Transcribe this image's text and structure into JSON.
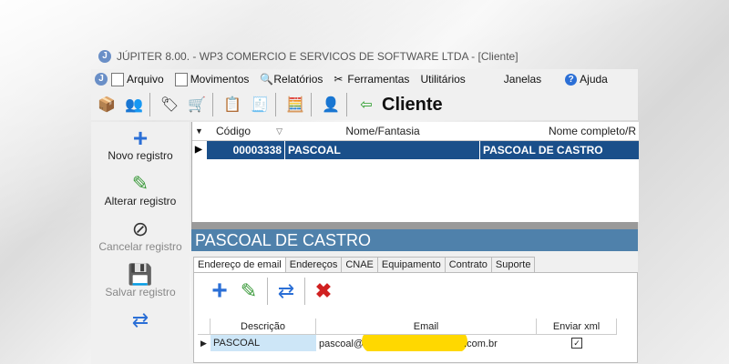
{
  "window": {
    "title": "JÚPITER 8.00. - WP3 COMERCIO E SERVICOS DE SOFTWARE LTDA - [Cliente]"
  },
  "menu": [
    {
      "label": "Arquivo",
      "icon": "document-icon"
    },
    {
      "label": "Movimentos",
      "icon": "document-icon"
    },
    {
      "label": "Relatórios",
      "icon": "print-preview-icon"
    },
    {
      "label": "Ferramentas",
      "icon": "tools-icon"
    },
    {
      "label": "Utilitários",
      "icon": ""
    },
    {
      "label": "Janelas",
      "icon": ""
    },
    {
      "label": "Ajuda",
      "icon": "help-icon"
    }
  ],
  "toolbar": {
    "title": "Cliente"
  },
  "left_panel": {
    "new": "Novo registro",
    "edit": "Alterar registro",
    "cancel": "Cancelar registro",
    "save": "Salvar registro"
  },
  "grid": {
    "columns": [
      "Código",
      "Nome/Fantasia",
      "Nome completo/R"
    ],
    "rows": [
      {
        "codigo": "00003338",
        "fantasia": "PASCOAL",
        "nome": "PASCOAL DE CASTRO"
      }
    ]
  },
  "detail": {
    "header": "PASCOAL DE CASTRO",
    "tabs": [
      "Endereço de email",
      "Endereços",
      "CNAE",
      "Equipamento",
      "Contrato",
      "Suporte"
    ],
    "email_grid": {
      "columns": [
        "Descrição",
        "Email",
        "Enviar xml"
      ],
      "rows": [
        {
          "descricao": "PASCOAL",
          "email_start": "pascoal@",
          "email_end": ".com.br",
          "enviar_xml": true
        }
      ]
    }
  },
  "colors": {
    "selection": "#1a4f8a",
    "header_bar": "#4f81ab",
    "redaction": "#ffd800"
  }
}
